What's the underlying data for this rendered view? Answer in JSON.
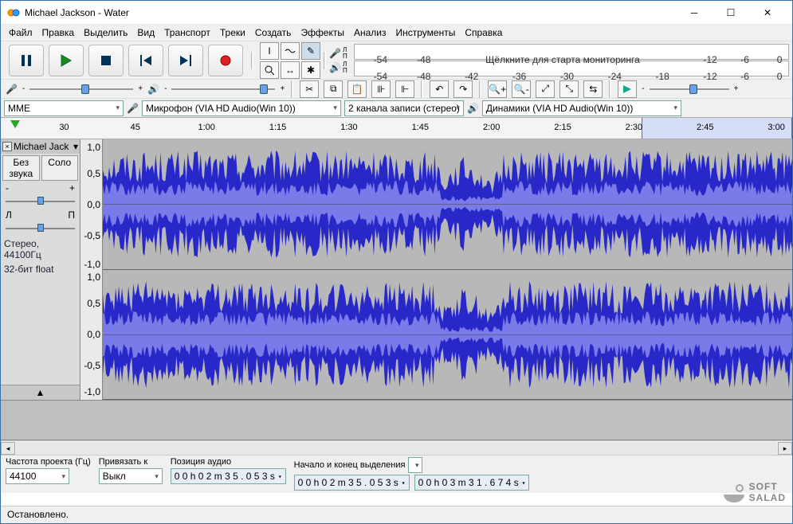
{
  "window": {
    "title": "Michael Jackson - Water"
  },
  "menu": [
    "Файл",
    "Правка",
    "Выделить",
    "Вид",
    "Транспорт",
    "Треки",
    "Создать",
    "Эффекты",
    "Анализ",
    "Инструменты",
    "Справка"
  ],
  "meters": {
    "rec_ticks": [
      "-54",
      "-48",
      "-12",
      "-6",
      "0"
    ],
    "rec_hint": "Щёлкните для старта мониторинга",
    "play_ticks": [
      "-54",
      "-48",
      "-42",
      "-36",
      "-30",
      "-24",
      "-18",
      "-12",
      "-6",
      "0"
    ]
  },
  "devices": {
    "host": "MME",
    "input": "Микрофон (VIA HD Audio(Win 10))",
    "channels": "2 канала записи (стерео)",
    "output": "Динамики (VIA HD Audio(Win 10))"
  },
  "ruler": {
    "ticks": [
      {
        "label": "30",
        "pct": 5
      },
      {
        "label": "45",
        "pct": 16
      },
      {
        "label": "1:00",
        "pct": 27
      },
      {
        "label": "1:15",
        "pct": 37
      },
      {
        "label": "1:30",
        "pct": 47
      },
      {
        "label": "1:45",
        "pct": 57
      },
      {
        "label": "2:00",
        "pct": 67
      },
      {
        "label": "2:15",
        "pct": 77
      },
      {
        "label": "2:30",
        "pct": 87
      },
      {
        "label": "2:45",
        "pct": 95
      },
      {
        "label": "3:00",
        "pct": 103
      }
    ],
    "selection": {
      "start_pct": 81,
      "end_pct": 100
    }
  },
  "track": {
    "name": "Michael Jack",
    "mute": "Без звука",
    "solo": "Соло",
    "info1": "Стерео, 44100Гц",
    "info2": "32-бит float",
    "vscale": [
      "1,0",
      "0,5",
      "0,0",
      "-0,5",
      "-1,0"
    ]
  },
  "selection_bar": {
    "rate_label": "Частота проекта (Гц)",
    "rate_value": "44100",
    "snap_label": "Привязать к",
    "snap_value": "Выкл",
    "pos_label": "Позиция аудио",
    "pos_value": "0 0 h 0 2 m 3 5 . 0 5 3 s",
    "range_label": "Начало и конец выделения",
    "range_start": "0 0 h 0 2 m 3 5 . 0 5 3 s",
    "range_end": "0 0 h 0 3 m 3 1 . 6 7 4 s"
  },
  "status": "Остановлено.",
  "watermark": {
    "l1": "SOFT",
    "l2": "SALAD"
  }
}
